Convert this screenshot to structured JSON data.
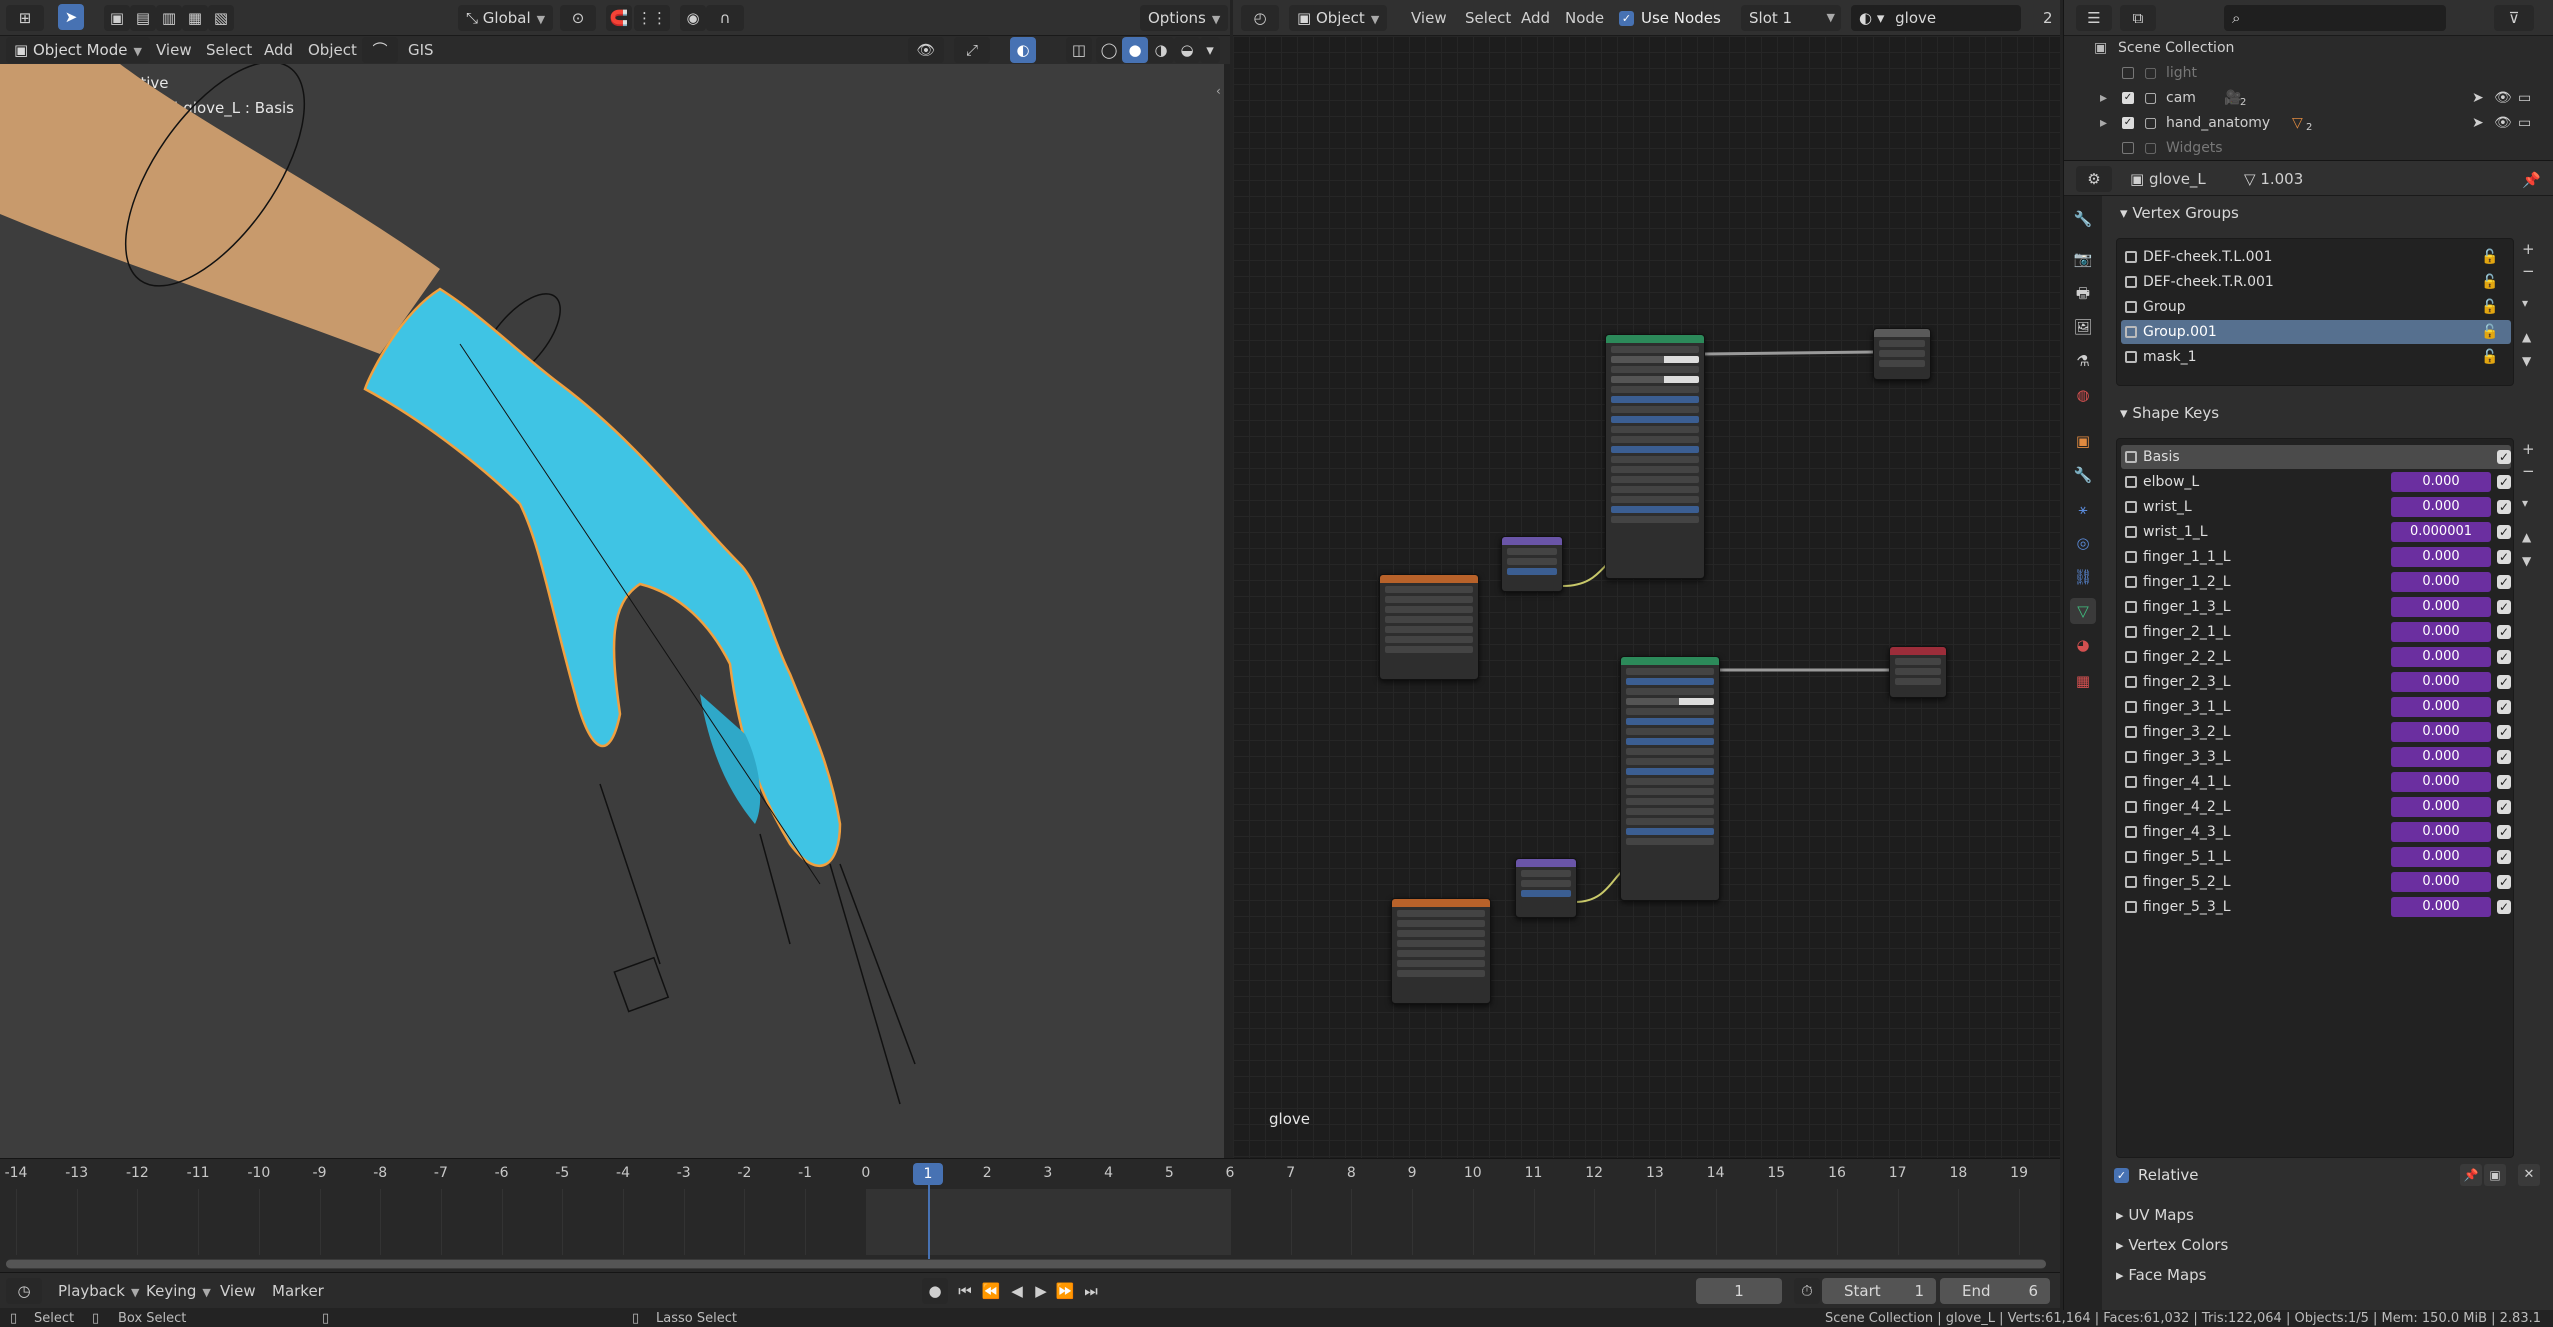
{
  "viewport_header": {
    "transform_orientation": "Global",
    "options": "Options",
    "mode": "Object Mode",
    "menus": [
      "View",
      "Select",
      "Add",
      "Object"
    ],
    "gis": "GIS"
  },
  "viewport": {
    "camera_label": "Camera Perspective",
    "object_info": "(1) Scene Collection | glove_L : Basis"
  },
  "node_header": {
    "type": "Object",
    "menus": [
      "View",
      "Select",
      "Add",
      "Node"
    ],
    "use_nodes": "Use Nodes",
    "slot": "Slot 1",
    "material": "glove",
    "users": "2"
  },
  "node_editor": {
    "material_label": "glove"
  },
  "timeline": {
    "ticks": [
      "-14",
      "-13",
      "-12",
      "-11",
      "-10",
      "-9",
      "-8",
      "-7",
      "-6",
      "-5",
      "-4",
      "-3",
      "-2",
      "-1",
      "0",
      "1",
      "2",
      "3",
      "4",
      "5",
      "6",
      "7",
      "8",
      "9",
      "10",
      "11",
      "12",
      "13",
      "14",
      "15",
      "16",
      "17",
      "18",
      "19"
    ],
    "current_frame": "1",
    "menus": [
      "Playback",
      "Keying",
      "View",
      "Marker"
    ],
    "frame_field": "1",
    "start_label": "Start",
    "start_value": "1",
    "end_label": "End",
    "end_value": "6"
  },
  "outliner": {
    "scene": "Scene Collection",
    "items": [
      {
        "name": "light",
        "checked": false
      },
      {
        "name": "cam",
        "checked": true,
        "badge": "2"
      },
      {
        "name": "hand_anatomy",
        "checked": true,
        "badge": "2"
      },
      {
        "name": "Widgets",
        "checked": false
      }
    ]
  },
  "properties": {
    "object_name": "glove_L",
    "mesh_users": "1.003",
    "vertex_groups_title": "Vertex Groups",
    "vertex_groups": [
      "DEF-cheek.T.L.001",
      "DEF-cheek.T.R.001",
      "Group",
      "Group.001",
      "mask_1"
    ],
    "selected_group": "Group.001",
    "shape_keys_title": "Shape Keys",
    "shape_keys": [
      {
        "name": "Basis",
        "value": ""
      },
      {
        "name": "elbow_L",
        "value": "0.000"
      },
      {
        "name": "wrist_L",
        "value": "0.000"
      },
      {
        "name": "wrist_1_L",
        "value": "0.000001"
      },
      {
        "name": "finger_1_1_L",
        "value": "0.000"
      },
      {
        "name": "finger_1_2_L",
        "value": "0.000"
      },
      {
        "name": "finger_1_3_L",
        "value": "0.000"
      },
      {
        "name": "finger_2_1_L",
        "value": "0.000"
      },
      {
        "name": "finger_2_2_L",
        "value": "0.000"
      },
      {
        "name": "finger_2_3_L",
        "value": "0.000"
      },
      {
        "name": "finger_3_1_L",
        "value": "0.000"
      },
      {
        "name": "finger_3_2_L",
        "value": "0.000"
      },
      {
        "name": "finger_3_3_L",
        "value": "0.000"
      },
      {
        "name": "finger_4_1_L",
        "value": "0.000"
      },
      {
        "name": "finger_4_2_L",
        "value": "0.000"
      },
      {
        "name": "finger_4_3_L",
        "value": "0.000"
      },
      {
        "name": "finger_5_1_L",
        "value": "0.000"
      },
      {
        "name": "finger_5_2_L",
        "value": "0.000"
      },
      {
        "name": "finger_5_3_L",
        "value": "0.000"
      }
    ],
    "relative": "Relative",
    "collapsed": [
      "UV Maps",
      "Vertex Colors",
      "Face Maps"
    ]
  },
  "status": {
    "select": "Select",
    "box_select": "Box Select",
    "lasso_select": "Lasso Select",
    "stats": "Scene Collection | glove_L | Verts:61,164 | Faces:61,032 | Tris:122,064 | Objects:1/5 | Mem: 150.0 MiB | 2.83.1"
  },
  "colors": {
    "accent": "#4772b3",
    "shape_key_value": "#6b2fa0",
    "glove": "#3fc4e4",
    "skin": "#c89a6c",
    "principled_header": "#2c8a5a",
    "image_header": "#b8622a",
    "normal_header": "#6a55a8",
    "output_header": "#9c2d3a"
  }
}
